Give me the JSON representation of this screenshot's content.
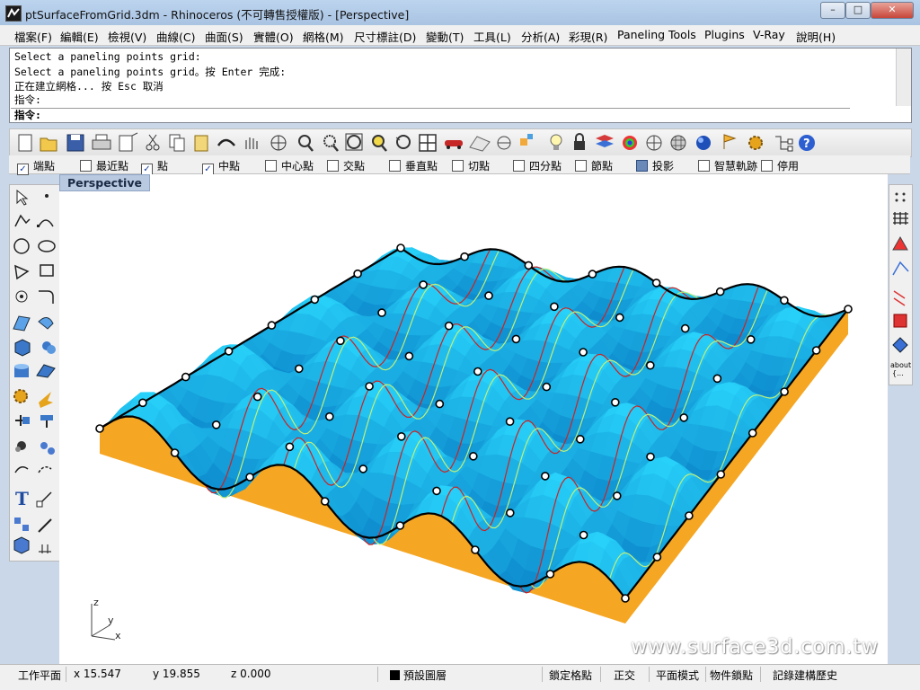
{
  "window": {
    "title": "ptSurfaceFromGrid.3dm - Rhinoceros (不可轉售授權版) - [Perspective]",
    "minimize": "–",
    "maximize": "□",
    "close": "✕"
  },
  "menu": [
    "檔案(F)",
    "編輯(E)",
    "檢視(V)",
    "曲線(C)",
    "曲面(S)",
    "實體(O)",
    "網格(M)",
    "尺寸標註(D)",
    "變動(T)",
    "工具(L)",
    "分析(A)",
    "彩現(R)",
    "Paneling Tools",
    "Plugins",
    "V-Ray",
    "說明(H)"
  ],
  "command": {
    "history": [
      "Select a paneling points grid:",
      "Select a paneling points grid。按 Enter 完成:",
      "正在建立網格... 按 Esc 取消",
      "指令:"
    ],
    "prompt": "指令:"
  },
  "toolbar_icons": [
    "new-icon",
    "open-icon",
    "save-icon",
    "print-icon",
    "import-icon",
    "cut-icon",
    "copy-icon",
    "paste-icon",
    "undo-icon",
    "pan-icon",
    "rotate-icon",
    "zoom-icon",
    "zoom-window-icon",
    "zoom-extents-icon",
    "zoom-selected-icon",
    "undo-view-icon",
    "four-viewports-icon",
    "car-icon",
    "grid-icon",
    "cplane-icon",
    "point-icon",
    "light-icon",
    "lock-icon",
    "layer-icon",
    "color-wheel-icon",
    "material-icon",
    "mesh-render-icon",
    "render-sphere-icon",
    "flag-icon",
    "gear-icon",
    "tree-icon",
    "help-icon"
  ],
  "osnaps": [
    {
      "label": "端點",
      "checked": true
    },
    {
      "label": "最近點",
      "checked": false
    },
    {
      "label": "點",
      "checked": true
    },
    {
      "label": "中點",
      "checked": true
    },
    {
      "label": "中心點",
      "checked": false
    },
    {
      "label": "交點",
      "checked": false
    },
    {
      "label": "垂直點",
      "checked": false
    },
    {
      "label": "切點",
      "checked": false
    },
    {
      "label": "四分點",
      "checked": false
    },
    {
      "label": "節點",
      "checked": false
    },
    {
      "label": "投影",
      "checked": true
    },
    {
      "label": "智慧軌跡",
      "checked": false
    },
    {
      "label": "停用",
      "checked": false
    }
  ],
  "viewport": {
    "name": "Perspective",
    "axes": {
      "z": "z",
      "y": "y",
      "x": "x"
    },
    "watermark": "www.surface3d.com.tw",
    "colors": {
      "surface": "#1fb0ee",
      "underside": "#f5a623",
      "edge": "#000000",
      "isocurve_red": "#cc2222",
      "isocurve_green": "#bff07a"
    }
  },
  "right_toolbar": {
    "about_label": "about",
    "about_dots": "{..."
  },
  "status": {
    "cplane": "工作平面",
    "x": "x 15.547",
    "y": "y 19.855",
    "z": "z 0.000",
    "layer": "預設圖層",
    "grid_snap": "鎖定格點",
    "ortho": "正交",
    "planar": "平面模式",
    "osnap": "物件鎖點",
    "history": "記錄建構歷史"
  }
}
